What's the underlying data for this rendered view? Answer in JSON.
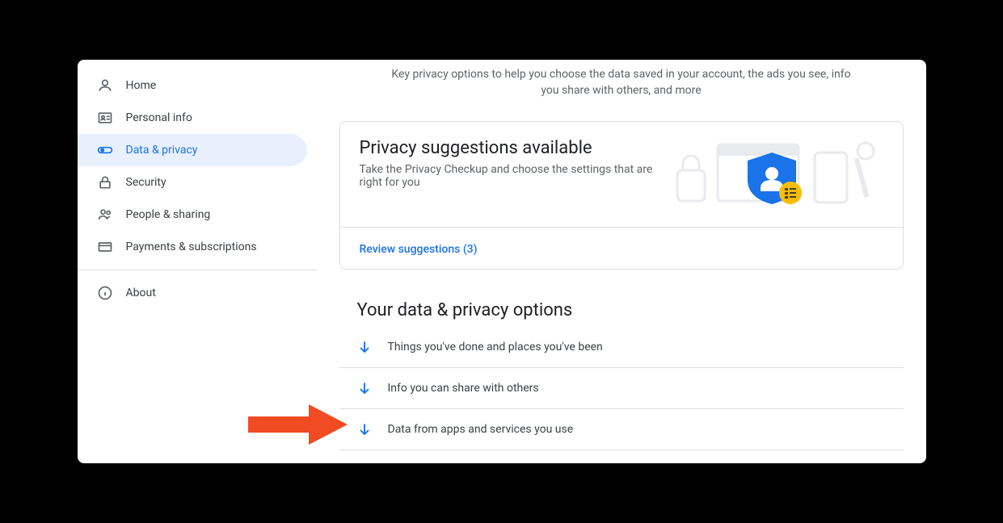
{
  "header": {
    "subtitle": "Key privacy options to help you choose the data saved in your account, the ads you see, info you share with others, and more"
  },
  "sidebar": {
    "items": [
      {
        "label": "Home"
      },
      {
        "label": "Personal info"
      },
      {
        "label": "Data & privacy"
      },
      {
        "label": "Security"
      },
      {
        "label": "People & sharing"
      },
      {
        "label": "Payments & subscriptions"
      },
      {
        "label": "About"
      }
    ]
  },
  "card": {
    "title": "Privacy suggestions available",
    "description": "Take the Privacy Checkup and choose the settings that are right for you",
    "action_label": "Review suggestions (3)"
  },
  "options": {
    "section_title": "Your data & privacy options",
    "items": [
      {
        "label": "Things you've done and places you've been"
      },
      {
        "label": "Info you can share with others"
      },
      {
        "label": "Data from apps and services you use"
      }
    ]
  }
}
